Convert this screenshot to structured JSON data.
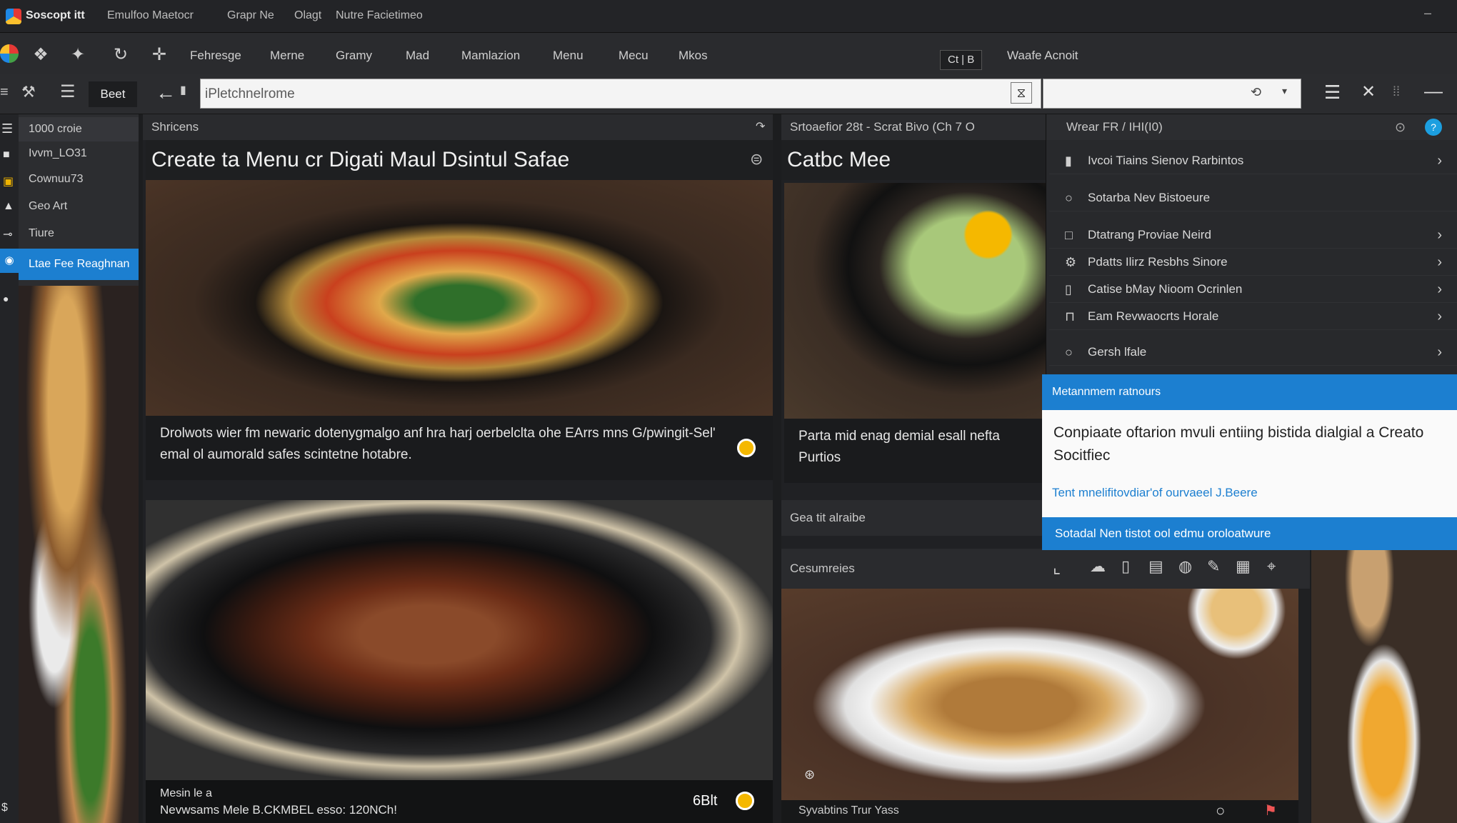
{
  "window": {
    "app_name": "Soscopt itt",
    "tabs": [
      "Emulfoo Maetocr",
      "Grapr Ne",
      "Olagt",
      "Nutre Facietimeo"
    ]
  },
  "menubar": {
    "items": [
      "Fehresge",
      "Merne",
      "Gramy",
      "Mad",
      "Mamlazion",
      "Menu",
      "Mecu",
      "Mkos"
    ],
    "mini_toggle": "Ct | B",
    "account_label": "Waafe Acnoit"
  },
  "toolrow": {
    "back_label": "Beet",
    "address_value": "iPletchnelrome"
  },
  "sidebar": {
    "items": [
      "1000 croie",
      "Ivvm_LO31",
      "Cownuu73",
      "Geo Art",
      "Tiure",
      "Ltae Fee Reaghnan"
    ]
  },
  "main": {
    "section_label": "Shricens",
    "card1": {
      "title": "Create ta Menu cr Digati Maul Dsintul Safae",
      "caption": "Drolwots wier fm newaric dotenygmalgo anf hra harj oerbelclta ohe EArrs mns G/pwingit-Sel' emal ol aumorald safes scintetne hotabre."
    },
    "card2": {
      "footer_line1": "Mesin le a",
      "footer_line2": "Nevwsams Mele B.CKMBEL esso: 120NCh!",
      "footer_price": "6Blt"
    }
  },
  "center": {
    "header": "Srtoaefior 28t - Scrat Bivo (Ch 7 O",
    "card_title": "Catbc Mee",
    "caption": "Parta mid enag demial esall nefta Purtios",
    "section2": "Gea tit alraibe",
    "section3": "Cesumreies",
    "bottom_label": "Syvabtins Trur Yass"
  },
  "dropdown": {
    "header": "Wrear FR / IHI(I0)",
    "items": [
      {
        "label": "Ivcoi Tiains Sienov Rarbintos",
        "icon": "doc-icon",
        "chevron": true
      },
      {
        "label": "Sotarba Nev Bistoeure",
        "icon": "circle-icon",
        "chevron": false
      },
      {
        "label": "Dtatrang Proviae Neird",
        "icon": "square-icon",
        "chevron": true
      },
      {
        "label": "Pdatts Ilirz Resbhs Sinore",
        "icon": "gear-icon",
        "chevron": true
      },
      {
        "label": "Catise bMay Nioom Ocrinlen",
        "icon": "doc-icon",
        "chevron": true
      },
      {
        "label": "Eam Revwaocrts Horale",
        "icon": "bag-icon",
        "chevron": true
      },
      {
        "label": "Gersh lfale",
        "icon": "circle-icon",
        "chevron": true
      }
    ],
    "highlight_header": "Metannmem ratnours",
    "tooltip_text": "Conpiaate oftarion mvuli entiing bistida dialgial a Creato Socitfiec",
    "tooltip_link": "Tent mnelifitovdiar'of ourvaeel J.Beere",
    "selected_item": "Sotadal Nen tistot ool edmu oroloatwure"
  },
  "colors": {
    "accent_blue": "#1c7fd0",
    "status_yellow": "#f5b800",
    "bg_dark": "#1c1d1f",
    "panel": "#2a2b2e"
  }
}
